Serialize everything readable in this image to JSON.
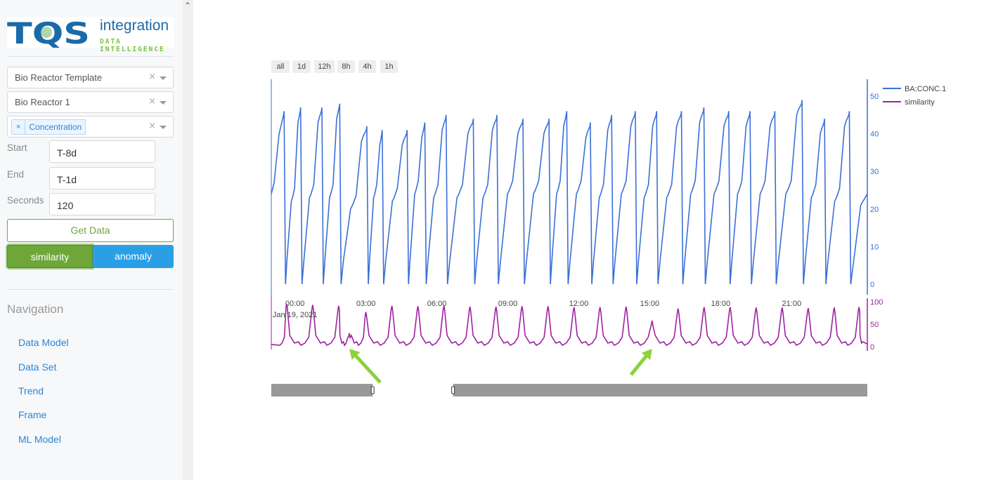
{
  "logo": {
    "mark": "TQS",
    "name": "integration",
    "tagline": "DATA INTELLIGENCE"
  },
  "filters": {
    "template": {
      "value": "Bio Reactor Template",
      "clear": "×"
    },
    "asset": {
      "value": "Bio Reactor 1",
      "clear": "×"
    },
    "attributes": {
      "tags": [
        {
          "remove": "×",
          "label": "Concentration"
        }
      ],
      "clear": "×"
    }
  },
  "fields": {
    "start": {
      "label": "Start",
      "value": "T-8d"
    },
    "end": {
      "label": "End",
      "value": "T-1d"
    },
    "seconds": {
      "label": "Seconds",
      "value": "120"
    }
  },
  "buttons": {
    "get_data": "Get Data",
    "similarity": "similarity",
    "anomaly": "anomaly"
  },
  "navigation": {
    "title": "Navigation",
    "items": [
      {
        "label": "Data Model"
      },
      {
        "label": "Data Set"
      },
      {
        "label": "Trend"
      },
      {
        "label": "Frame"
      },
      {
        "label": "ML Model"
      }
    ]
  },
  "range_selector": [
    "all",
    "1d",
    "12h",
    "8h",
    "4h",
    "1h"
  ],
  "colors": {
    "conc": "#3a6fd8",
    "similarity": "#a020a0",
    "annotation_arrow": "#8dd13f",
    "rangeslider": "#999999"
  },
  "chart_data": {
    "type": "line",
    "title": "",
    "xlabel": "",
    "x_ticks": [
      "00:00",
      "03:00",
      "06:00",
      "09:00",
      "12:00",
      "15:00",
      "18:00",
      "21:00"
    ],
    "x_date_label": "Jan 19, 2021",
    "x_range_hours": [
      -1.0,
      24.2
    ],
    "legend": {
      "placement": "top-right",
      "entries": [
        "BA:CONC.1",
        "similarity"
      ]
    },
    "series": [
      {
        "name": "BA:CONC.1",
        "axis": "y",
        "ylim": [
          0,
          55
        ],
        "yticks": [
          0,
          10,
          20,
          30,
          40,
          50
        ],
        "cycles": [
          {
            "start": -1.0,
            "mid": 24,
            "peak": 46
          },
          {
            "start": -0.4,
            "mid": 23,
            "peak": 47
          },
          {
            "start": 0.3,
            "mid": 24,
            "peak": 47
          },
          {
            "start": 1.2,
            "mid": 24,
            "peak": 48
          },
          {
            "start": 1.95,
            "mid": 21,
            "peak": 42
          },
          {
            "start": 3.1,
            "mid": 24,
            "peak": 41
          },
          {
            "start": 3.75,
            "mid": 23,
            "peak": 41
          },
          {
            "start": 4.8,
            "mid": 25,
            "peak": 43
          },
          {
            "start": 5.55,
            "mid": 24,
            "peak": 45
          },
          {
            "start": 6.45,
            "mid": 24,
            "peak": 44
          },
          {
            "start": 7.6,
            "mid": 24,
            "peak": 45
          },
          {
            "start": 8.6,
            "mid": 25,
            "peak": 44
          },
          {
            "start": 9.7,
            "mid": 25,
            "peak": 44
          },
          {
            "start": 10.8,
            "mid": 25,
            "peak": 46
          },
          {
            "start": 11.55,
            "mid": 25,
            "peak": 43
          },
          {
            "start": 12.55,
            "mid": 24,
            "peak": 45
          },
          {
            "start": 13.45,
            "mid": 25,
            "peak": 46
          },
          {
            "start": 14.45,
            "mid": 24,
            "peak": 46
          },
          {
            "start": 15.35,
            "mid": 24,
            "peak": 46
          },
          {
            "start": 16.4,
            "mid": 25,
            "peak": 47
          },
          {
            "start": 17.35,
            "mid": 25,
            "peak": 46
          },
          {
            "start": 18.4,
            "mid": 25,
            "peak": 46
          },
          {
            "start": 19.3,
            "mid": 25,
            "peak": 46
          },
          {
            "start": 20.35,
            "mid": 25,
            "peak": 49
          },
          {
            "start": 21.5,
            "mid": 24,
            "peak": 44
          },
          {
            "start": 22.45,
            "mid": 23,
            "peak": 46
          },
          {
            "start": 23.5,
            "mid": 24,
            "peak": 24
          }
        ]
      },
      {
        "name": "similarity",
        "axis": "y2",
        "ylim": [
          0,
          100
        ],
        "yticks": [
          0,
          50,
          100
        ],
        "baseline": 3,
        "peaks": [
          {
            "x": -0.35,
            "value": 95
          },
          {
            "x": 0.75,
            "value": 93
          },
          {
            "x": 1.85,
            "value": 91
          },
          {
            "x": 2.3,
            "value": 30
          },
          {
            "x": 3.0,
            "value": 77
          },
          {
            "x": 4.1,
            "value": 91
          },
          {
            "x": 5.2,
            "value": 90
          },
          {
            "x": 6.3,
            "value": 91
          },
          {
            "x": 7.4,
            "value": 89
          },
          {
            "x": 8.5,
            "value": 89
          },
          {
            "x": 9.6,
            "value": 90
          },
          {
            "x": 10.7,
            "value": 90
          },
          {
            "x": 11.8,
            "value": 88
          },
          {
            "x": 12.9,
            "value": 88
          },
          {
            "x": 14.0,
            "value": 89
          },
          {
            "x": 15.1,
            "value": 58
          },
          {
            "x": 16.2,
            "value": 85
          },
          {
            "x": 17.3,
            "value": 88
          },
          {
            "x": 18.4,
            "value": 88
          },
          {
            "x": 19.5,
            "value": 87
          },
          {
            "x": 20.6,
            "value": 87
          },
          {
            "x": 21.7,
            "value": 86
          },
          {
            "x": 22.8,
            "value": 87
          },
          {
            "x": 23.85,
            "value": 88
          }
        ]
      }
    ],
    "annotations": [
      {
        "type": "arrow",
        "points_to_x": 2.3,
        "label": ""
      },
      {
        "type": "arrow",
        "points_to_x": 15.1,
        "label": ""
      }
    ],
    "rangeslider": {
      "visible": true,
      "selected_fraction": [
        0.17,
        0.305
      ]
    }
  }
}
